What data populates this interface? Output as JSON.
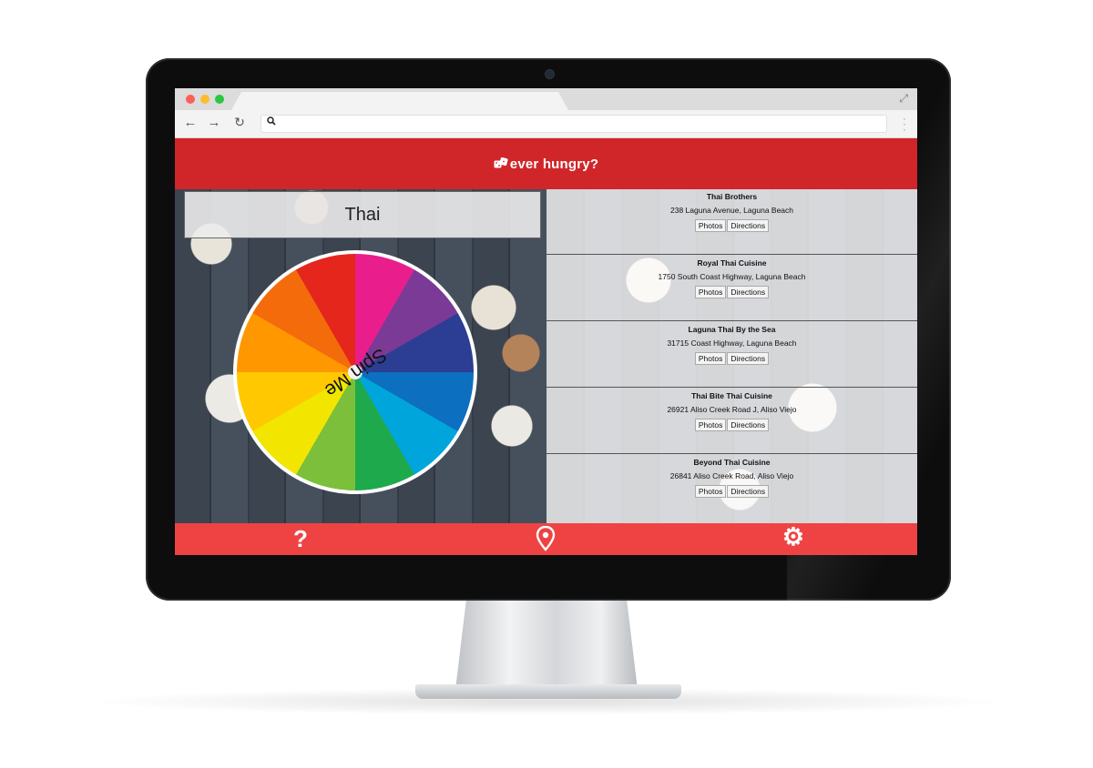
{
  "browser": {
    "nav": {
      "back": "←",
      "forward": "→",
      "reload": "↻"
    },
    "address_placeholder": "",
    "icons": [
      "search-icon",
      "expand-icon",
      "menu-icon"
    ]
  },
  "app": {
    "title": "ever hungry?",
    "logo_icon": "dice-icon",
    "category": "Thai",
    "spin_label": "Spin Me",
    "wheel_colors": [
      "#e91e8c",
      "#7b3a96",
      "#2b3e93",
      "#0d6fbf",
      "#00a5dc",
      "#1ea94d",
      "#7cbf3a",
      "#f2e600",
      "#ffc800",
      "#ff9800",
      "#f46b0c",
      "#e4261d"
    ],
    "results": [
      {
        "name": "Thai Brothers",
        "address": "238 Laguna Avenue, Laguna Beach",
        "photos": "Photos",
        "directions": "Directions"
      },
      {
        "name": "Royal Thai Cuisine",
        "address": "1750 South Coast Highway, Laguna Beach",
        "photos": "Photos",
        "directions": "Directions"
      },
      {
        "name": "Laguna Thai By the Sea",
        "address": "31715 Coast Highway, Laguna Beach",
        "photos": "Photos",
        "directions": "Directions"
      },
      {
        "name": "Thai Bite Thai Cuisine",
        "address": "26921 Aliso Creek Road J, Aliso Viejo",
        "photos": "Photos",
        "directions": "Directions"
      },
      {
        "name": "Beyond Thai Cuisine",
        "address": "26841 Aliso Creek Road, Aliso Viejo",
        "photos": "Photos",
        "directions": "Directions"
      }
    ],
    "footer": {
      "help": "?",
      "location_icon": "map-pin-icon",
      "settings_icon": "gear-icon"
    },
    "colors": {
      "header": "#d0262a",
      "footer": "#ef4343"
    }
  }
}
